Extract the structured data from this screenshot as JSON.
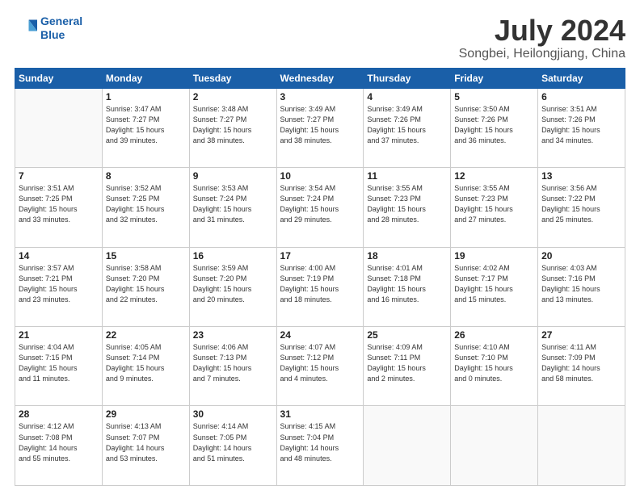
{
  "header": {
    "logo_line1": "General",
    "logo_line2": "Blue",
    "title": "July 2024",
    "subtitle": "Songbei, Heilongjiang, China"
  },
  "calendar": {
    "weekdays": [
      "Sunday",
      "Monday",
      "Tuesday",
      "Wednesday",
      "Thursday",
      "Friday",
      "Saturday"
    ],
    "weeks": [
      [
        {
          "day": "",
          "info": ""
        },
        {
          "day": "1",
          "info": "Sunrise: 3:47 AM\nSunset: 7:27 PM\nDaylight: 15 hours\nand 39 minutes."
        },
        {
          "day": "2",
          "info": "Sunrise: 3:48 AM\nSunset: 7:27 PM\nDaylight: 15 hours\nand 38 minutes."
        },
        {
          "day": "3",
          "info": "Sunrise: 3:49 AM\nSunset: 7:27 PM\nDaylight: 15 hours\nand 38 minutes."
        },
        {
          "day": "4",
          "info": "Sunrise: 3:49 AM\nSunset: 7:26 PM\nDaylight: 15 hours\nand 37 minutes."
        },
        {
          "day": "5",
          "info": "Sunrise: 3:50 AM\nSunset: 7:26 PM\nDaylight: 15 hours\nand 36 minutes."
        },
        {
          "day": "6",
          "info": "Sunrise: 3:51 AM\nSunset: 7:26 PM\nDaylight: 15 hours\nand 34 minutes."
        }
      ],
      [
        {
          "day": "7",
          "info": "Sunrise: 3:51 AM\nSunset: 7:25 PM\nDaylight: 15 hours\nand 33 minutes."
        },
        {
          "day": "8",
          "info": "Sunrise: 3:52 AM\nSunset: 7:25 PM\nDaylight: 15 hours\nand 32 minutes."
        },
        {
          "day": "9",
          "info": "Sunrise: 3:53 AM\nSunset: 7:24 PM\nDaylight: 15 hours\nand 31 minutes."
        },
        {
          "day": "10",
          "info": "Sunrise: 3:54 AM\nSunset: 7:24 PM\nDaylight: 15 hours\nand 29 minutes."
        },
        {
          "day": "11",
          "info": "Sunrise: 3:55 AM\nSunset: 7:23 PM\nDaylight: 15 hours\nand 28 minutes."
        },
        {
          "day": "12",
          "info": "Sunrise: 3:55 AM\nSunset: 7:23 PM\nDaylight: 15 hours\nand 27 minutes."
        },
        {
          "day": "13",
          "info": "Sunrise: 3:56 AM\nSunset: 7:22 PM\nDaylight: 15 hours\nand 25 minutes."
        }
      ],
      [
        {
          "day": "14",
          "info": "Sunrise: 3:57 AM\nSunset: 7:21 PM\nDaylight: 15 hours\nand 23 minutes."
        },
        {
          "day": "15",
          "info": "Sunrise: 3:58 AM\nSunset: 7:20 PM\nDaylight: 15 hours\nand 22 minutes."
        },
        {
          "day": "16",
          "info": "Sunrise: 3:59 AM\nSunset: 7:20 PM\nDaylight: 15 hours\nand 20 minutes."
        },
        {
          "day": "17",
          "info": "Sunrise: 4:00 AM\nSunset: 7:19 PM\nDaylight: 15 hours\nand 18 minutes."
        },
        {
          "day": "18",
          "info": "Sunrise: 4:01 AM\nSunset: 7:18 PM\nDaylight: 15 hours\nand 16 minutes."
        },
        {
          "day": "19",
          "info": "Sunrise: 4:02 AM\nSunset: 7:17 PM\nDaylight: 15 hours\nand 15 minutes."
        },
        {
          "day": "20",
          "info": "Sunrise: 4:03 AM\nSunset: 7:16 PM\nDaylight: 15 hours\nand 13 minutes."
        }
      ],
      [
        {
          "day": "21",
          "info": "Sunrise: 4:04 AM\nSunset: 7:15 PM\nDaylight: 15 hours\nand 11 minutes."
        },
        {
          "day": "22",
          "info": "Sunrise: 4:05 AM\nSunset: 7:14 PM\nDaylight: 15 hours\nand 9 minutes."
        },
        {
          "day": "23",
          "info": "Sunrise: 4:06 AM\nSunset: 7:13 PM\nDaylight: 15 hours\nand 7 minutes."
        },
        {
          "day": "24",
          "info": "Sunrise: 4:07 AM\nSunset: 7:12 PM\nDaylight: 15 hours\nand 4 minutes."
        },
        {
          "day": "25",
          "info": "Sunrise: 4:09 AM\nSunset: 7:11 PM\nDaylight: 15 hours\nand 2 minutes."
        },
        {
          "day": "26",
          "info": "Sunrise: 4:10 AM\nSunset: 7:10 PM\nDaylight: 15 hours\nand 0 minutes."
        },
        {
          "day": "27",
          "info": "Sunrise: 4:11 AM\nSunset: 7:09 PM\nDaylight: 14 hours\nand 58 minutes."
        }
      ],
      [
        {
          "day": "28",
          "info": "Sunrise: 4:12 AM\nSunset: 7:08 PM\nDaylight: 14 hours\nand 55 minutes."
        },
        {
          "day": "29",
          "info": "Sunrise: 4:13 AM\nSunset: 7:07 PM\nDaylight: 14 hours\nand 53 minutes."
        },
        {
          "day": "30",
          "info": "Sunrise: 4:14 AM\nSunset: 7:05 PM\nDaylight: 14 hours\nand 51 minutes."
        },
        {
          "day": "31",
          "info": "Sunrise: 4:15 AM\nSunset: 7:04 PM\nDaylight: 14 hours\nand 48 minutes."
        },
        {
          "day": "",
          "info": ""
        },
        {
          "day": "",
          "info": ""
        },
        {
          "day": "",
          "info": ""
        }
      ]
    ]
  }
}
